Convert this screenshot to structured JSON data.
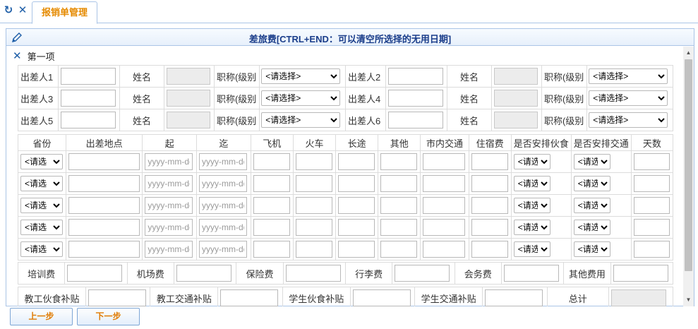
{
  "tab": {
    "label": "报销单管理"
  },
  "panel": {
    "title": "差旅费[CTRL+END：可以清空所选择的无用日期]"
  },
  "section": {
    "title": "第一项"
  },
  "persons": {
    "traveler_labels": [
      "出差人1",
      "出差人2",
      "出差人3",
      "出差人4",
      "出差人5",
      "出差人6"
    ],
    "name_label": "姓名",
    "title_label": "职称(级别",
    "select_placeholder": "<请选择>"
  },
  "trips": {
    "headers": [
      "省份",
      "出差地点",
      "起",
      "迄",
      "飞机",
      "火车",
      "长途",
      "其他",
      "市内交通",
      "住宿费",
      "是否安排伙食",
      "是否安排交通",
      "天数"
    ],
    "province_option": "<请选",
    "date_placeholder": "yyyy-mm-dd",
    "small_option": "<请选"
  },
  "fees": {
    "labels": [
      "培训费",
      "机场费",
      "保险费",
      "行李费",
      "会务费",
      "其他费用"
    ]
  },
  "subsidies": {
    "labels": [
      "教工伙食补贴",
      "教工交通补贴",
      "学生伙食补贴",
      "学生交通补贴",
      "总计"
    ]
  },
  "buttons": {
    "prev": "上一步",
    "next": "下一步"
  },
  "colors": {
    "accent": "#e58a00",
    "title": "#1a3d8a",
    "border": "#aac4e6"
  }
}
